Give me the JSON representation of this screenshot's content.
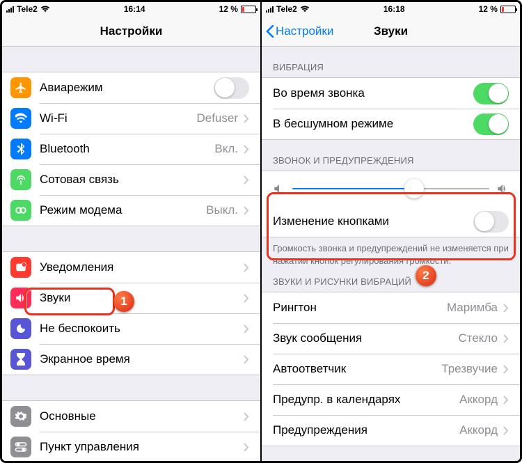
{
  "left": {
    "status": {
      "carrier": "Tele2",
      "time": "16:14",
      "battery_pct": "12 %"
    },
    "nav": {
      "title": "Настройки"
    },
    "g1": [
      {
        "icon": "airplane",
        "color": "c-orange",
        "label": "Авиарежим",
        "type": "toggle",
        "on": false
      },
      {
        "icon": "wifi",
        "color": "c-blue",
        "label": "Wi-Fi",
        "detail": "Defuser",
        "type": "link"
      },
      {
        "icon": "bluetooth",
        "color": "c-blue",
        "label": "Bluetooth",
        "detail": "Вкл.",
        "type": "link"
      },
      {
        "icon": "antenna",
        "color": "c-green",
        "label": "Сотовая связь",
        "type": "link"
      },
      {
        "icon": "hotspot",
        "color": "c-green",
        "label": "Режим модема",
        "detail": "Выкл.",
        "type": "link"
      }
    ],
    "g2": [
      {
        "icon": "notif",
        "color": "c-red",
        "label": "Уведомления",
        "type": "link"
      },
      {
        "icon": "sound",
        "color": "c-pink",
        "label": "Звуки",
        "type": "link",
        "hl": true
      },
      {
        "icon": "moon",
        "color": "c-indigo",
        "label": "Не беспокоить",
        "type": "link"
      },
      {
        "icon": "hourglass",
        "color": "c-indigo",
        "label": "Экранное время",
        "type": "link"
      }
    ],
    "g3": [
      {
        "icon": "gear",
        "color": "c-gray",
        "label": "Основные",
        "type": "link"
      },
      {
        "icon": "switches",
        "color": "c-gray",
        "label": "Пункт управления",
        "type": "link"
      }
    ]
  },
  "right": {
    "status": {
      "carrier": "Tele2",
      "time": "16:18",
      "battery_pct": "12 %"
    },
    "nav": {
      "back": "Настройки",
      "title": "Звуки"
    },
    "vibration_header": "ВИБРАЦИЯ",
    "vibration": [
      {
        "label": "Во время звонка",
        "on": true
      },
      {
        "label": "В бесшумном режиме",
        "on": true
      }
    ],
    "ringer_header": "ЗВОНОК И ПРЕДУПРЕЖДЕНИЯ",
    "slider_value": 62,
    "change_buttons": {
      "label": "Изменение кнопками",
      "on": false
    },
    "ringer_footer": "Громкость звонка и предупреждений не изменяется при нажатии кнопок регулирования громкости.",
    "sounds_header": "ЗВУКИ И РИСУНКИ ВИБРАЦИЙ",
    "sounds": [
      {
        "label": "Рингтон",
        "detail": "Маримба"
      },
      {
        "label": "Звук сообщения",
        "detail": "Стекло"
      },
      {
        "label": "Автоответчик",
        "detail": "Трезвучие"
      },
      {
        "label": "Предупр. в календарях",
        "detail": "Аккорд"
      },
      {
        "label": "Предупреждения",
        "detail": "Аккорд"
      }
    ]
  },
  "callouts": {
    "one": "1",
    "two": "2"
  }
}
